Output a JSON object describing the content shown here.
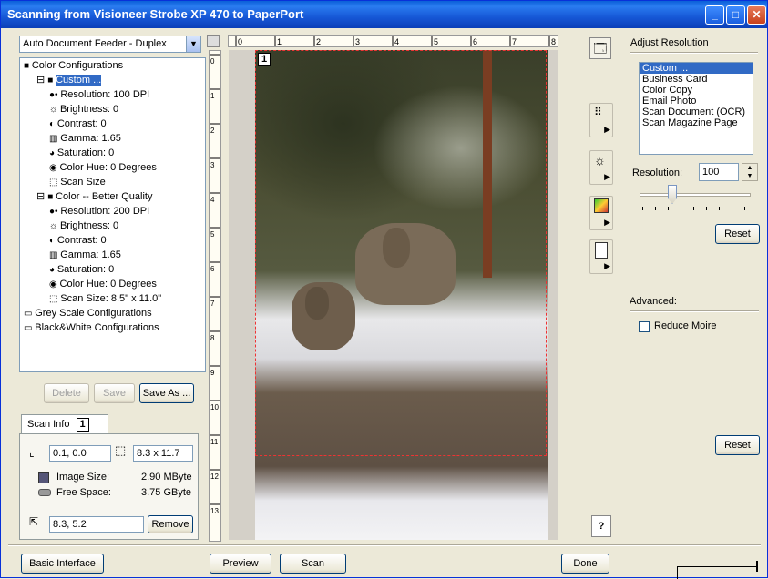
{
  "window": {
    "title": "Scanning from Visioneer Strobe XP 470 to PaperPort"
  },
  "left": {
    "source_select": "Auto Document Feeder - Duplex",
    "tree": [
      {
        "label": "Color Configurations"
      },
      {
        "label": "Custom ..."
      },
      {
        "label": "Resolution: 100 DPI"
      },
      {
        "label": "Brightness: 0"
      },
      {
        "label": "Contrast: 0"
      },
      {
        "label": "Gamma: 1.65"
      },
      {
        "label": "Saturation: 0"
      },
      {
        "label": "Color Hue: 0 Degrees"
      },
      {
        "label": "Scan Size"
      },
      {
        "label": "Color -- Better Quality"
      },
      {
        "label": "Resolution: 200 DPI"
      },
      {
        "label": "Brightness: 0"
      },
      {
        "label": "Contrast: 0"
      },
      {
        "label": "Gamma: 1.65"
      },
      {
        "label": "Saturation: 0"
      },
      {
        "label": "Color Hue: 0 Degrees"
      },
      {
        "label": "Scan Size: 8.5\" x 11.0\""
      },
      {
        "label": "Grey Scale Configurations"
      },
      {
        "label": "Black&White Configurations"
      }
    ],
    "delete_label": "Delete",
    "save_label": "Save",
    "save_as_label": "Save As ...",
    "scan_info_tab": "Scan Info",
    "scan_info_page": "1",
    "origin": "0.1, 0.0",
    "size": "8.3 x 11.7",
    "image_size_label": "Image Size:",
    "image_size_value": "2.90 MByte",
    "free_space_label": "Free Space:",
    "free_space_value": "3.75 GByte",
    "pointer_pos": "8.3, 5.2",
    "remove_label": "Remove"
  },
  "preview": {
    "page_number": "1",
    "ruler_numbers": [
      "0",
      "1",
      "2",
      "3",
      "4",
      "5",
      "6",
      "7",
      "8"
    ],
    "vruler_numbers": [
      "0",
      "1",
      "2",
      "3",
      "4",
      "5",
      "6",
      "7",
      "8",
      "9",
      "10",
      "11",
      "12",
      "13"
    ]
  },
  "right": {
    "adjust_title": "Adjust Resolution",
    "presets": [
      "Custom ...",
      "Business Card",
      "Color Copy",
      "Email Photo",
      "Scan Document (OCR)",
      "Scan Magazine Page"
    ],
    "resolution_label": "Resolution:",
    "resolution_value": "100",
    "reset_label": "Reset",
    "advanced_label": "Advanced:",
    "reduce_moire_label": "Reduce Moire",
    "reset2_label": "Reset"
  },
  "bottom": {
    "basic_label": "Basic Interface",
    "preview_label": "Preview",
    "scan_label": "Scan",
    "done_label": "Done"
  }
}
